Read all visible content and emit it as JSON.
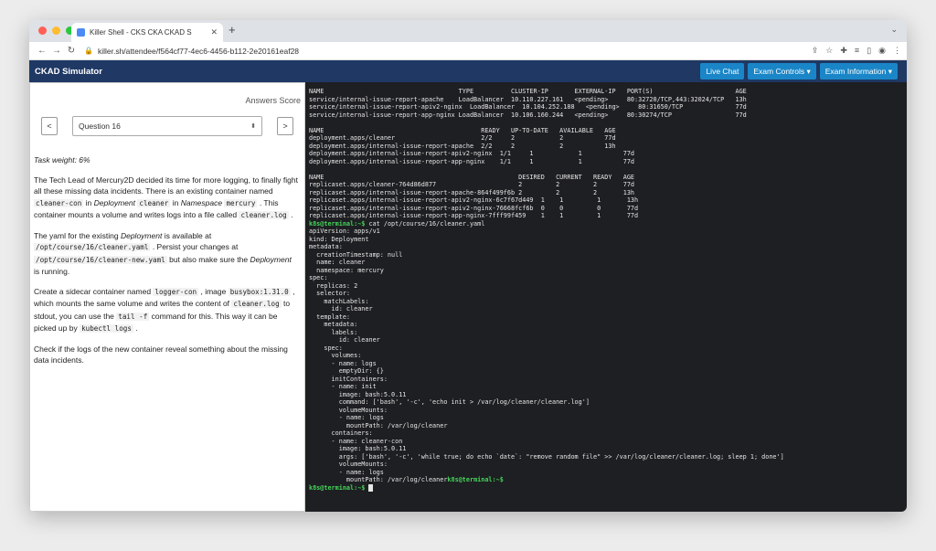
{
  "browser": {
    "tab_title": "Killer Shell - CKS CKA CKAD S",
    "url": "killer.sh/attendee/f564cf77-4ec6-4456-b112-2e20161eaf28"
  },
  "app": {
    "brand": "CKAD Simulator",
    "buttons": [
      "Live Chat",
      "Exam Controls ▾",
      "Exam Information ▾"
    ]
  },
  "question": {
    "answers_score": "Answers Score",
    "prev": "<",
    "next": ">",
    "selected": "Question 16",
    "weight": "Task weight: 6%",
    "p1": [
      {
        "t": "The Tech Lead of Mercury2D decided its time for more logging, to finally fight all these missing data incidents. There is an existing container named "
      },
      {
        "c": "cleaner-con"
      },
      {
        "t": " in "
      },
      {
        "i": "Deployment"
      },
      {
        "t": " "
      },
      {
        "c": "cleaner"
      },
      {
        "t": " in "
      },
      {
        "i": "Namespace"
      },
      {
        "t": " "
      },
      {
        "c": "mercury"
      },
      {
        "t": " . This container mounts a volume and writes logs into a file called "
      },
      {
        "c": "cleaner.log"
      },
      {
        "t": " ."
      }
    ],
    "p2": [
      {
        "t": "The yaml for the existing "
      },
      {
        "i": "Deployment"
      },
      {
        "t": " is available at "
      },
      {
        "c": "/opt/course/16/cleaner.yaml"
      },
      {
        "t": " . Persist your changes at "
      },
      {
        "c": "/opt/course/16/cleaner-new.yaml"
      },
      {
        "t": " but also make sure the "
      },
      {
        "i": "Deployment"
      },
      {
        "t": " is running."
      }
    ],
    "p3": [
      {
        "t": "Create a sidecar container named "
      },
      {
        "c": "logger-con"
      },
      {
        "t": " , image "
      },
      {
        "c": "busybox:1.31.0"
      },
      {
        "t": " , which mounts the same volume and writes the content of "
      },
      {
        "c": "cleaner.log"
      },
      {
        "t": " to stdout, you can use the "
      },
      {
        "c": "tail -f"
      },
      {
        "t": " command for this. This way it can be picked up by "
      },
      {
        "c": "kubectl logs"
      },
      {
        "t": " ."
      }
    ],
    "p4": [
      {
        "t": "Check if the logs of the new container reveal something about the missing data incidents."
      }
    ]
  },
  "terminal": {
    "lines": [
      "NAME                                    TYPE          CLUSTER-IP       EXTERNAL-IP   PORT(S)                      AGE",
      "service/internal-issue-report-apache    LoadBalancer  10.110.227.161   <pending>     80:32720/TCP,443:32024/TCP   13h",
      "service/internal-issue-report-apiv2-nginx  LoadBalancer  10.104.252.188   <pending>     80:31650/TCP              77d",
      "service/internal-issue-report-app-nginx LoadBalancer  10.106.160.244   <pending>     80:30274/TCP                 77d",
      "",
      "NAME                                          READY   UP-TO-DATE   AVAILABLE   AGE",
      "deployment.apps/cleaner                       2/2     2            2           77d",
      "deployment.apps/internal-issue-report-apache  2/2     2            2           13h",
      "deployment.apps/internal-issue-report-apiv2-nginx  1/1     1            1           77d",
      "deployment.apps/internal-issue-report-app-nginx    1/1     1            1           77d",
      "",
      "NAME                                                    DESIRED   CURRENT   READY   AGE",
      "replicaset.apps/cleaner-764d86d877                      2         2         2       77d",
      "replicaset.apps/internal-issue-report-apache-864f499f6b 2         2         2       13h",
      "replicaset.apps/internal-issue-report-apiv2-nginx-6c7f67d449  1    1         1       13h",
      "replicaset.apps/internal-issue-report-apiv2-nginx-76668fcf6b  0    0         0       77d",
      "replicaset.apps/internal-issue-report-app-nginx-7fff99f459    1    1         1       77d",
      {
        "p": "k8s@terminal:~$",
        "t": " cat /opt/course/16/cleaner.yaml"
      },
      "apiVersion: apps/v1",
      "kind: Deployment",
      "metadata:",
      "  creationTimestamp: null",
      "  name: cleaner",
      "  namespace: mercury",
      "spec:",
      "  replicas: 2",
      "  selector:",
      "    matchLabels:",
      "      id: cleaner",
      "  template:",
      "    metadata:",
      "      labels:",
      "        id: cleaner",
      "    spec:",
      "      volumes:",
      "      - name: logs",
      "        emptyDir: {}",
      "      initContainers:",
      "      - name: init",
      "        image: bash:5.0.11",
      "        command: ['bash', '-c', 'echo init > /var/log/cleaner/cleaner.log']",
      "        volumeMounts:",
      "        - name: logs",
      "          mountPath: /var/log/cleaner",
      "      containers:",
      "      - name: cleaner-con",
      "        image: bash:5.0.11",
      "        args: ['bash', '-c', 'while true; do echo `date`: \"remove random file\" >> /var/log/cleaner/cleaner.log; sleep 1; done']",
      "        volumeMounts:",
      "        - name: logs",
      {
        "t": "          mountPath: /var/log/cleaner",
        "p2": "k8s@terminal:~$"
      },
      {
        "p": "k8s@terminal:~$",
        "cursor": true
      }
    ]
  },
  "colors": {
    "appbar": "#1f3864",
    "button": "#1a86c7",
    "terminal_bg": "#1e1f22",
    "prompt": "#44d45a"
  }
}
